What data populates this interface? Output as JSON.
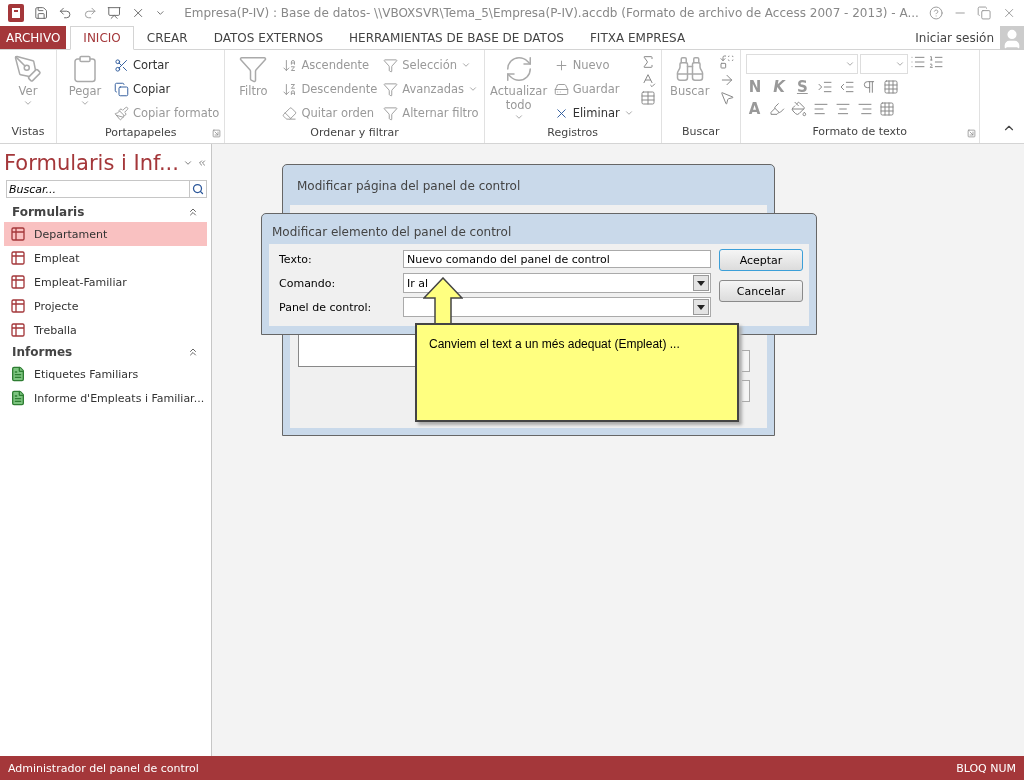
{
  "window": {
    "title": "Empresa(P-IV) : Base de datos- \\\\VBOXSVR\\Tema_5\\Empresa(P-IV).accdb (Formato de archivo de Access 2007 - 2013) - A..."
  },
  "tabs": [
    {
      "label": "ARCHIVO",
      "kind": "file",
      "selected": false
    },
    {
      "label": "INICIO",
      "kind": "tab",
      "selected": true
    },
    {
      "label": "CREAR",
      "kind": "tab",
      "selected": false
    },
    {
      "label": "DATOS EXTERNOS",
      "kind": "tab",
      "selected": false
    },
    {
      "label": "HERRAMIENTAS DE BASE DE DATOS",
      "kind": "tab",
      "selected": false
    },
    {
      "label": "FITXA EMPRESA",
      "kind": "tab",
      "selected": false
    }
  ],
  "account": {
    "label": "Iniciar sesión"
  },
  "ribbon": {
    "groups": [
      {
        "label": "Vistas",
        "launcher": false,
        "large": [
          {
            "label": "Ver",
            "dropdown": true,
            "disabled": true
          }
        ]
      },
      {
        "label": "Portapapeles",
        "launcher": true,
        "large": [
          {
            "label": "Pegar",
            "dropdown": true,
            "disabled": true
          }
        ],
        "columns": [
          [
            {
              "label": "Cortar",
              "dropdown": false,
              "disabled": false
            },
            {
              "label": "Copiar",
              "dropdown": false,
              "disabled": false
            },
            {
              "label": "Copiar formato",
              "dropdown": false,
              "disabled": true
            }
          ]
        ]
      },
      {
        "label": "Ordenar y filtrar",
        "launcher": false,
        "large": [
          {
            "label": "Filtro",
            "dropdown": false,
            "disabled": true
          }
        ],
        "columns": [
          [
            {
              "label": "Ascendente",
              "dropdown": false,
              "disabled": true
            },
            {
              "label": "Descendente",
              "dropdown": false,
              "disabled": true
            },
            {
              "label": "Quitar orden",
              "dropdown": false,
              "disabled": true
            }
          ],
          [
            {
              "label": "Selección",
              "dropdown": true,
              "disabled": true
            },
            {
              "label": "Avanzadas",
              "dropdown": true,
              "disabled": true
            },
            {
              "label": "Alternar filtro",
              "dropdown": false,
              "disabled": true
            }
          ]
        ]
      },
      {
        "label": "Registros",
        "launcher": false,
        "large": [
          {
            "label": "Actualizar todo",
            "dropdown": true,
            "disabled": true
          }
        ],
        "columns": [
          [
            {
              "label": "Nuevo",
              "dropdown": false,
              "disabled": true
            },
            {
              "label": "Guardar",
              "dropdown": false,
              "disabled": true
            },
            {
              "label": "Eliminar",
              "dropdown": true,
              "disabled": false
            }
          ]
        ]
      },
      {
        "label": "Buscar",
        "launcher": false,
        "large": [
          {
            "label": "Buscar",
            "dropdown": false,
            "disabled": true
          }
        ]
      },
      {
        "label": "Formato de texto",
        "launcher": true
      }
    ]
  },
  "text_format": {
    "style_buttons": [
      "N",
      "K",
      "S"
    ],
    "color_button": "A"
  },
  "nav": {
    "title": "Formularis i Inf...",
    "search": {
      "placeholder": "Buscar..."
    },
    "sections": [
      {
        "label": "Formularis",
        "expanded": true,
        "items": [
          {
            "label": "Departament",
            "kind": "form",
            "selected": true
          },
          {
            "label": "Empleat",
            "kind": "form",
            "selected": false
          },
          {
            "label": "Empleat-Familiar",
            "kind": "form",
            "selected": false
          },
          {
            "label": "Projecte",
            "kind": "form",
            "selected": false
          },
          {
            "label": "Treballa",
            "kind": "form",
            "selected": false
          }
        ]
      },
      {
        "label": "Informes",
        "expanded": true,
        "items": [
          {
            "label": "Etiquetes Familiars",
            "kind": "report",
            "selected": false
          },
          {
            "label": "Informe d'Empleats i Familiar...",
            "kind": "report",
            "selected": false
          }
        ]
      }
    ]
  },
  "back_dialog": {
    "title": "Modificar página del panel de control"
  },
  "dialog": {
    "title": "Modificar elemento del panel de control",
    "fields": [
      {
        "label": "Texto:",
        "kind": "text",
        "value": "Nuevo comando del panel de control"
      },
      {
        "label": "Comando:",
        "kind": "combo",
        "value": "Ir al"
      },
      {
        "label": "Panel de control:",
        "kind": "combo"
      }
    ],
    "buttons": [
      {
        "label": "Aceptar",
        "default": true
      },
      {
        "label": "Cancelar",
        "default": false
      }
    ]
  },
  "callout": {
    "text": "Canviem el text a un més adequat (Empleat) ..."
  },
  "status_bar": {
    "left": "Administrador del panel de control",
    "right": "BLOQ NUM"
  }
}
